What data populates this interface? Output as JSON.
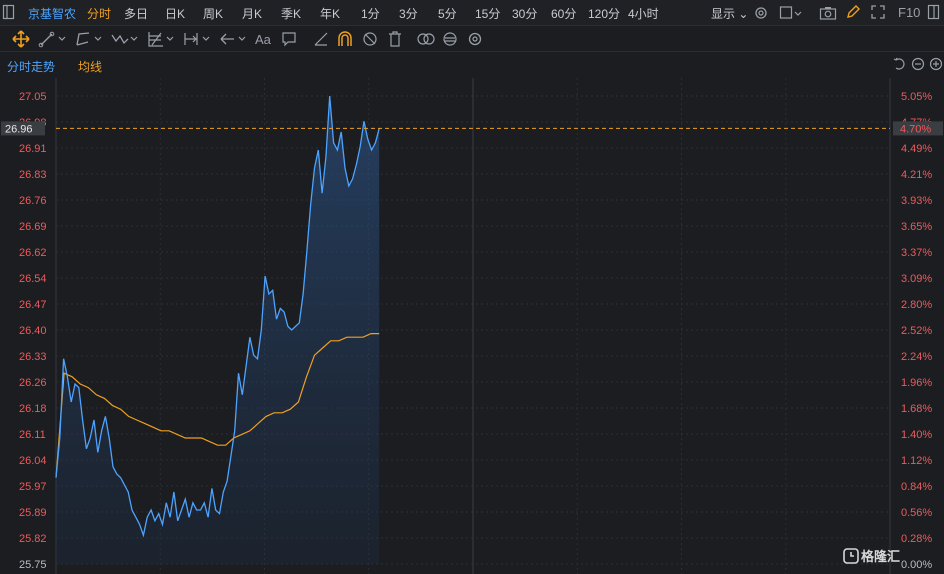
{
  "tabs": {
    "stock_name": "京基智农",
    "items": [
      "分时",
      "多日",
      "日K",
      "周K",
      "月K",
      "季K",
      "年K",
      "1分",
      "3分",
      "5分",
      "15分",
      "30分",
      "60分",
      "120分",
      "4小时"
    ],
    "active": "分时",
    "display_label": "显示",
    "f10_label": "F10"
  },
  "toolbar": {
    "text_tool_label": "Aa",
    "icons": [
      "move-icon",
      "line-icon",
      "channel-icon",
      "wave-icon",
      "fib-icon",
      "range-icon",
      "arrow-icon",
      "text-icon",
      "comment-icon",
      "ruler-icon",
      "magnet-icon",
      "hide-icon",
      "delete-icon",
      "link-icon",
      "sync-icon",
      "settings-icon"
    ]
  },
  "legend": {
    "price_label": "分时走势",
    "avg_label": "均线",
    "price_color": "#4da3ff",
    "avg_color": "#f0a020"
  },
  "chart_data": {
    "type": "line",
    "y_left_ticks": [
      "27.05",
      "26.98",
      "26.91",
      "26.83",
      "26.76",
      "26.69",
      "26.62",
      "26.54",
      "26.47",
      "26.40",
      "26.33",
      "26.26",
      "26.18",
      "26.11",
      "26.04",
      "25.97",
      "25.89",
      "25.82",
      "25.75"
    ],
    "y_right_ticks": [
      "5.05%",
      "4.77%",
      "4.49%",
      "4.21%",
      "3.93%",
      "3.65%",
      "3.37%",
      "3.09%",
      "2.80%",
      "2.52%",
      "2.24%",
      "1.96%",
      "1.68%",
      "1.40%",
      "1.12%",
      "0.84%",
      "0.56%",
      "0.28%",
      "0.00%"
    ],
    "ylim": [
      25.75,
      27.05
    ],
    "current_price": "26.96",
    "current_pct": "4.70%",
    "x_total": 240,
    "price": [
      25.99,
      26.1,
      26.32,
      26.27,
      26.2,
      26.25,
      26.24,
      26.15,
      26.07,
      26.1,
      26.15,
      26.06,
      26.12,
      26.16,
      26.1,
      26.02,
      26.0,
      25.99,
      25.97,
      25.95,
      25.9,
      25.88,
      25.86,
      25.83,
      25.88,
      25.9,
      25.87,
      25.89,
      25.86,
      25.92,
      25.88,
      25.95,
      25.87,
      25.9,
      25.93,
      25.88,
      25.92,
      25.9,
      25.9,
      25.92,
      25.88,
      25.96,
      25.9,
      25.89,
      25.95,
      25.98,
      26.05,
      26.12,
      26.28,
      26.22,
      26.3,
      26.38,
      26.33,
      26.32,
      26.4,
      26.55,
      26.5,
      26.51,
      26.43,
      26.46,
      26.45,
      26.41,
      26.4,
      26.41,
      26.42,
      26.5,
      26.62,
      26.75,
      26.85,
      26.9,
      26.78,
      26.88,
      27.05,
      26.92,
      26.9,
      26.95,
      26.85,
      26.8,
      26.82,
      26.86,
      26.91,
      26.98,
      26.93,
      26.9,
      26.92,
      26.96
    ],
    "avg": [
      25.99,
      26.28,
      26.27,
      26.25,
      26.24,
      26.22,
      26.21,
      26.19,
      26.18,
      26.16,
      26.15,
      26.14,
      26.13,
      26.12,
      26.12,
      26.11,
      26.1,
      26.1,
      26.1,
      26.09,
      26.08,
      26.08,
      26.1,
      26.11,
      26.12,
      26.14,
      26.16,
      26.17,
      26.17,
      26.18,
      26.2,
      26.27,
      26.33,
      26.35,
      26.37,
      26.37,
      26.38,
      26.38,
      26.38,
      26.39,
      26.39
    ]
  },
  "watermark": "格隆汇"
}
